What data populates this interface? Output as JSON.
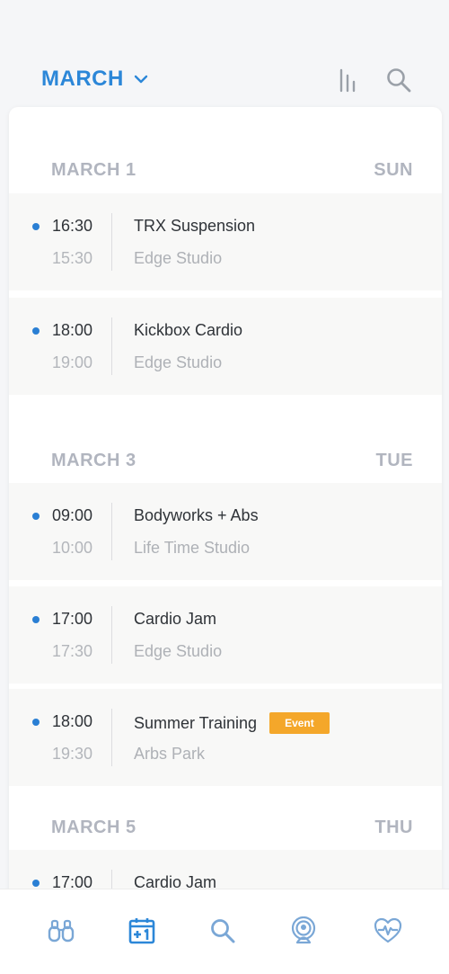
{
  "header": {
    "month_label": "MARCH",
    "icons": [
      "chevron-down-icon",
      "stats-icon",
      "search-icon"
    ],
    "accent_color": "#2c87d8"
  },
  "days": [
    {
      "date": "MARCH 1",
      "weekday": "SUN",
      "events": [
        {
          "start": "16:30",
          "end": "15:30",
          "title": "TRX Suspension",
          "location": "Edge Studio"
        },
        {
          "start": "18:00",
          "end": "19:00",
          "title": "Kickbox Cardio",
          "location": "Edge Studio"
        }
      ]
    },
    {
      "date": "MARCH 3",
      "weekday": "TUE",
      "events": [
        {
          "start": "09:00",
          "end": "10:00",
          "title": "Bodyworks + Abs",
          "location": "Life Time Studio"
        },
        {
          "start": "17:00",
          "end": "17:30",
          "title": "Cardio Jam",
          "location": "Edge Studio"
        },
        {
          "start": "18:00",
          "end": "19:30",
          "title": "Summer Training",
          "location": "Arbs Park",
          "badge": "Event"
        }
      ]
    },
    {
      "date": "MARCH 5",
      "weekday": "THU",
      "events": [
        {
          "start": "17:00",
          "end": "",
          "title": "Cardio Jam",
          "location": ""
        }
      ]
    }
  ],
  "tabbar": {
    "tabs": [
      {
        "icon": "binoculars-icon",
        "active": false
      },
      {
        "icon": "calendar-plus-one-icon",
        "active": true
      },
      {
        "icon": "search-icon",
        "active": false
      },
      {
        "icon": "broadcast-icon",
        "active": false
      },
      {
        "icon": "heart-rate-icon",
        "active": false
      }
    ],
    "colors": {
      "active": "#2c87d8",
      "inactive": "#7aa7d6"
    }
  }
}
